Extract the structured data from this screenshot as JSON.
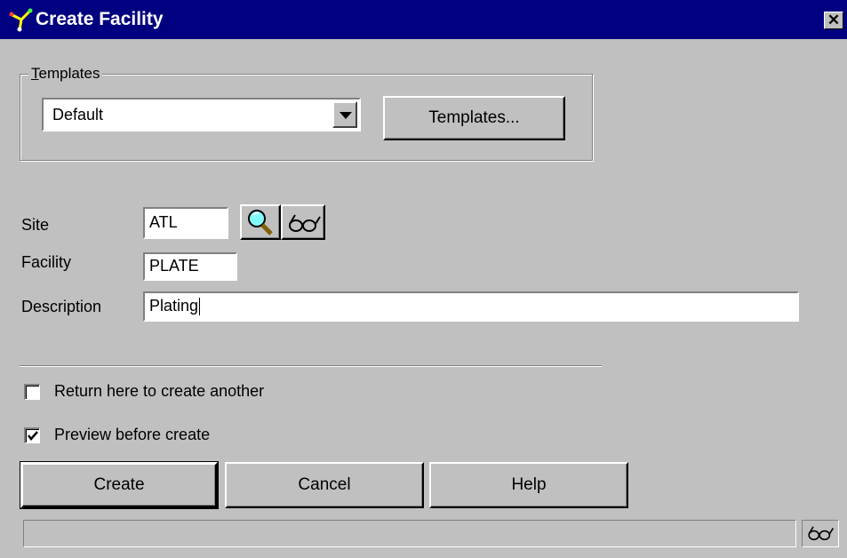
{
  "window": {
    "title": "Create Facility",
    "close_label": "✕"
  },
  "templates": {
    "group_label": "Templates",
    "combo_value": "Default",
    "button_label": "Templates..."
  },
  "form": {
    "site_label": "Site",
    "site_value": "ATL",
    "facility_label": "Facility",
    "facility_value": "PLATE",
    "description_label": "Description",
    "description_value": "Plating"
  },
  "options": {
    "return_label": "Return here to create another",
    "return_checked": false,
    "preview_label": "Preview before create",
    "preview_checked": true
  },
  "buttons": {
    "create": "Create",
    "cancel": "Cancel",
    "help": "Help"
  },
  "icons": {
    "app": "facility-app-icon",
    "search": "magnifier-icon",
    "lookup": "glasses-icon",
    "status": "glasses-icon"
  },
  "colors": {
    "titlebar": "#000080",
    "face": "#c0c0c0"
  }
}
